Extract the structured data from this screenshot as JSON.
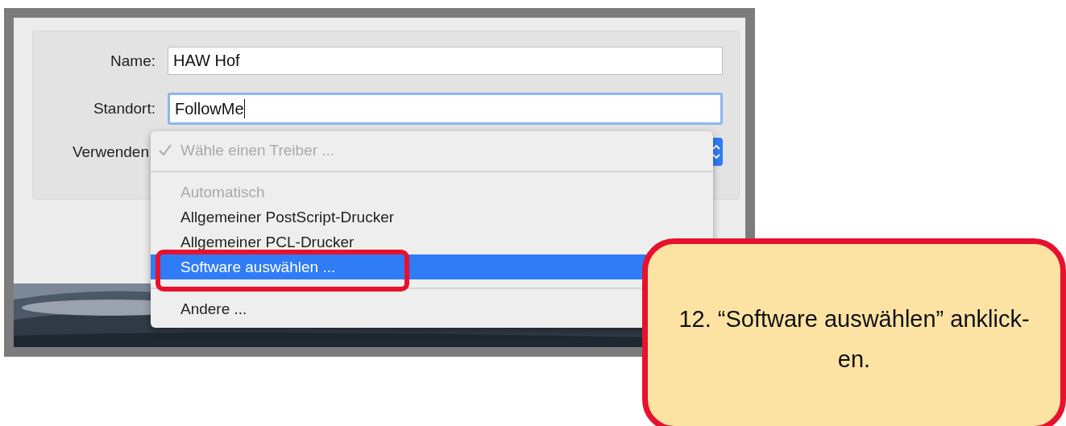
{
  "form": {
    "fields": [
      {
        "label": "Name:",
        "value": "HAW Hof",
        "focused": false
      },
      {
        "label": "Standort:",
        "value": "FollowMe",
        "focused": true
      }
    ],
    "driver_label": "Verwenden"
  },
  "menu": {
    "items": [
      {
        "kind": "item",
        "text": "Wähle einen Treiber ...",
        "checked": true,
        "disabled": true,
        "selected": false
      },
      {
        "kind": "separator"
      },
      {
        "kind": "item",
        "text": "Automatisch",
        "checked": false,
        "disabled": true,
        "selected": false
      },
      {
        "kind": "item",
        "text": "Allgemeiner PostScript-Drucker",
        "checked": false,
        "disabled": false,
        "selected": false
      },
      {
        "kind": "item",
        "text": "Allgemeiner PCL-Drucker",
        "checked": false,
        "disabled": false,
        "selected": false
      },
      {
        "kind": "item",
        "text": "Software auswählen ...",
        "checked": false,
        "disabled": false,
        "selected": true
      },
      {
        "kind": "separator"
      },
      {
        "kind": "item",
        "text": "Andere ...",
        "checked": false,
        "disabled": false,
        "selected": false
      }
    ]
  },
  "callout": {
    "lines": [
      "12. “Software auswählen” anklick-",
      "en."
    ]
  }
}
